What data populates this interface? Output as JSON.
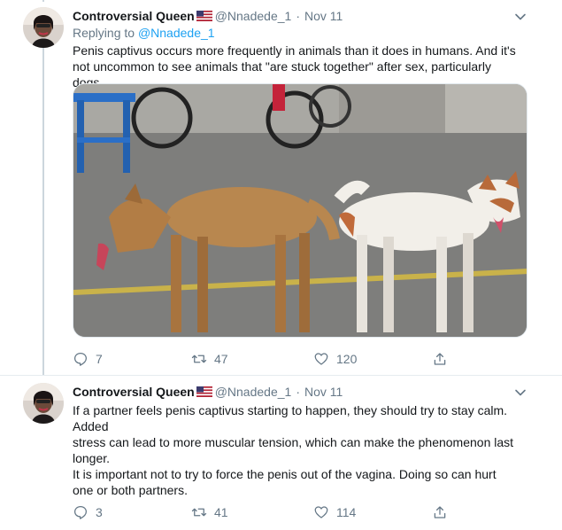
{
  "tweets": [
    {
      "author_name": "Controversial Queen",
      "flag_icon": "us-flag-icon",
      "handle": "@Nnadede_1",
      "separator": "·",
      "date": "Nov 11",
      "replying_prefix": "Replying to",
      "replying_to": "@Nnadede_1",
      "text_lines": [
        "Penis captivus occurs more frequently in animals than it does in humans. And it's",
        "not uncommon to see animals that \"are stuck together\" after sex, particularly dogs"
      ],
      "has_media": true,
      "actions": {
        "replies": "7",
        "retweets": "47",
        "likes": "120"
      }
    },
    {
      "author_name": "Controversial Queen",
      "flag_icon": "us-flag-icon",
      "handle": "@Nnadede_1",
      "separator": "·",
      "date": "Nov 11",
      "text_lines": [
        "If a partner feels penis captivus starting to happen, they should try to stay calm.",
        "Added",
        "stress can lead to more muscular tension, which can make the phenomenon last",
        "longer.",
        "It is important not to try to force the penis out of the vagina. Doing so can hurt",
        "one or both partners."
      ],
      "actions": {
        "replies": "3",
        "retweets": "41",
        "likes": "114"
      }
    }
  ],
  "icons": {
    "reply": "reply-icon",
    "retweet": "retweet-icon",
    "like": "heart-icon",
    "share": "share-icon",
    "more": "chevron-down-icon"
  },
  "colors": {
    "text": "#14171a",
    "secondary": "#657786",
    "link": "#1da1f2",
    "thread_line": "#ccd6dd"
  }
}
